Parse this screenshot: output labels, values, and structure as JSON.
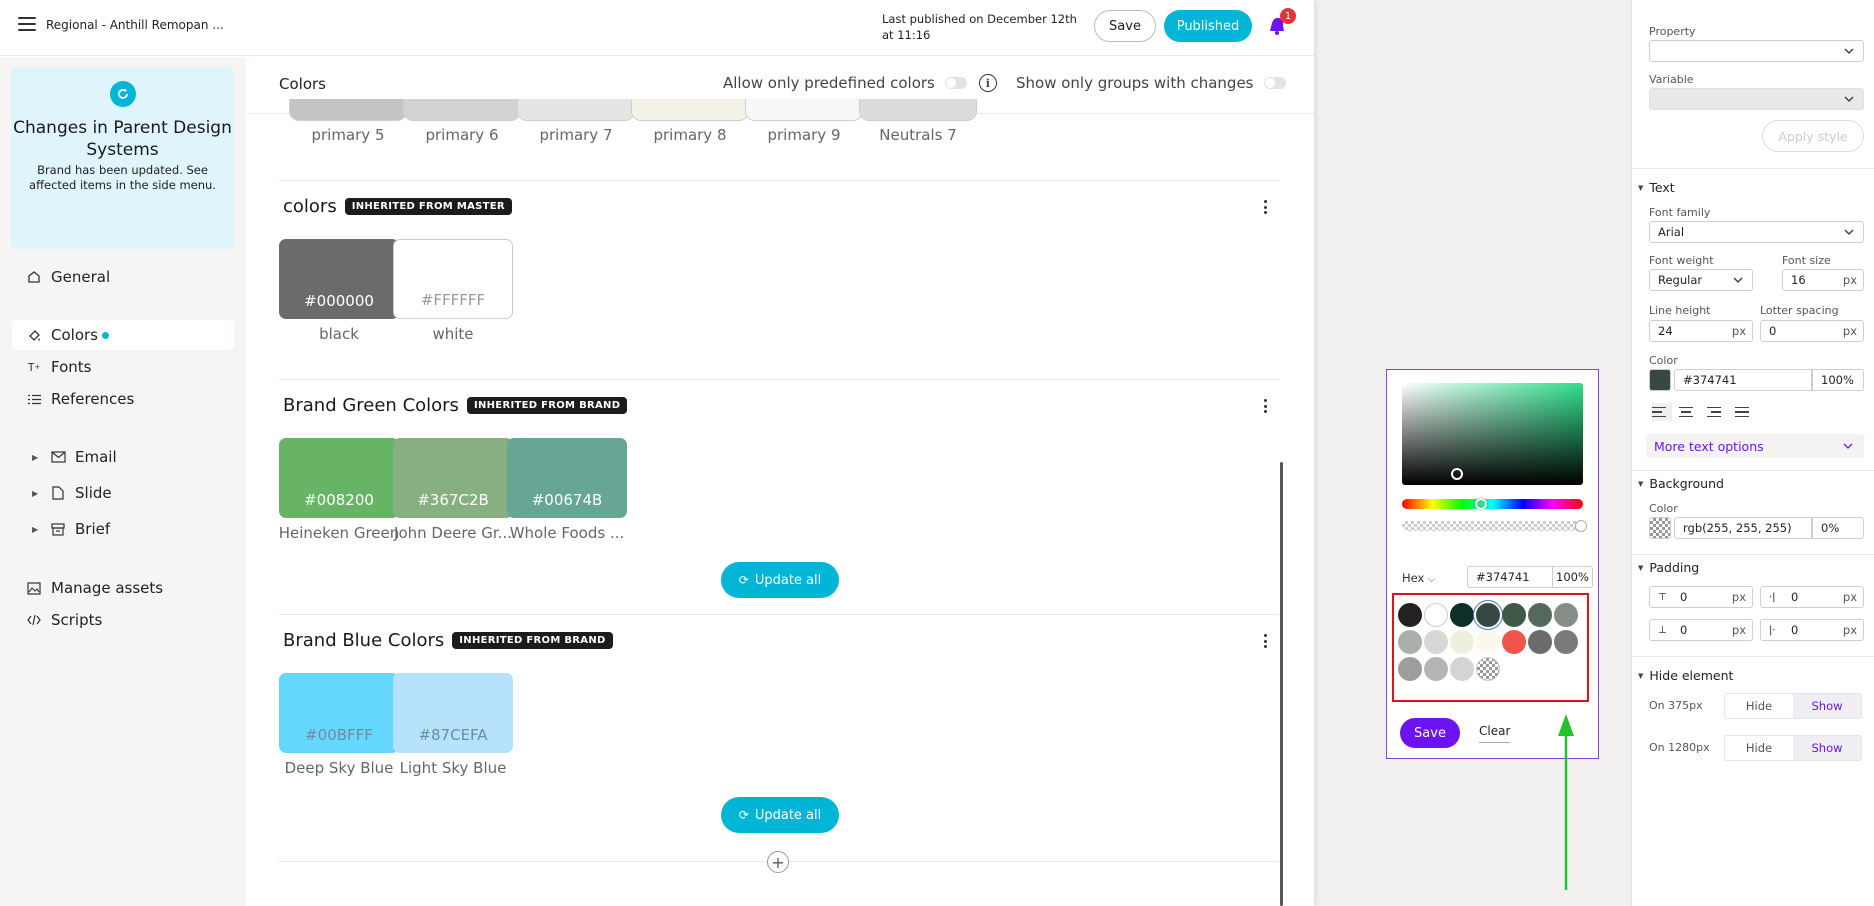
{
  "topbar": {
    "doc_title": "Regional - Anthill Remopan ...",
    "published_text": "Last published on December 12th at 11:16",
    "save_label": "Save",
    "published_label": "Published",
    "notification_count": "1"
  },
  "notice": {
    "title": "Changes in Parent Design Systems",
    "body": "Brand has been updated. See affected items in the side menu."
  },
  "sidebar": {
    "general": "General",
    "colors": "Colors",
    "fonts": "Fonts",
    "references": "References",
    "email": "Email",
    "slide": "Slide",
    "brief": "Brief",
    "manage_assets": "Manage assets",
    "scripts": "Scripts"
  },
  "content": {
    "header": "Colors",
    "toggle_predefined": "Allow only predefined colors",
    "toggle_groups": "Show only groups with changes",
    "top_row": [
      {
        "name": "primary 5",
        "color": "#c4c4c4"
      },
      {
        "name": "primary 6",
        "color": "#d2d2d2"
      },
      {
        "name": "primary 7",
        "color": "#e4e4e4"
      },
      {
        "name": "primary 8",
        "color": "#f4f2e6"
      },
      {
        "name": "primary 9",
        "color": "#f7f7f7"
      },
      {
        "name": "Neutrals 7",
        "color": "#dcdcdc"
      }
    ],
    "groups": [
      {
        "title": "colors",
        "badge": "INHERITED FROM MASTER",
        "swatches": [
          {
            "hex": "#000000",
            "name": "black",
            "bg": "#6b6b6b",
            "fg": "#ffffff"
          },
          {
            "hex": "#FFFFFF",
            "name": "white",
            "bg": "#ffffff",
            "fg": "#999999"
          }
        ]
      },
      {
        "title": "Brand Green Colors",
        "badge": "INHERITED FROM BRAND",
        "update_label": "Update all",
        "swatches": [
          {
            "hex": "#008200",
            "name": "Heineken Green",
            "bg": "#67b467",
            "fg": "#ffffff"
          },
          {
            "hex": "#367C2B",
            "name": "John Deere Gr...",
            "bg": "#88af82",
            "fg": "#ffffff"
          },
          {
            "hex": "#00674B",
            "name": "Whole Foods ...",
            "bg": "#67a595",
            "fg": "#ffffff"
          }
        ]
      },
      {
        "title": "Brand Blue Colors",
        "badge": "INHERITED FROM BRAND",
        "update_label": "Update all",
        "swatches": [
          {
            "hex": "#00BFFF",
            "name": "Deep Sky Blue",
            "bg": "#66d8ff",
            "fg": "#6a8fa0"
          },
          {
            "hex": "#87CEFA",
            "name": "Light Sky Blue",
            "bg": "#b7e2fc",
            "fg": "#6a8fa0"
          }
        ]
      }
    ]
  },
  "picker": {
    "mode": "Hex",
    "hex": "#374741",
    "alpha": "100%",
    "presets": [
      "#222222",
      "#ffffff",
      "#0f2e28",
      "#374741",
      "#3f5a48",
      "#56695e",
      "#858e86",
      "#a9b0aa",
      "#d5d8d5",
      "#efefe0",
      "#fbf8ec",
      "#f0554a",
      "#6b6b6b",
      "#7a7a7a",
      "#9d9d9d",
      "#b5b5b5",
      "#d4d4d4",
      "transparent"
    ],
    "save_label": "Save",
    "clear_label": "Clear"
  },
  "props": {
    "property_label": "Property",
    "variable_label": "Variable",
    "apply_label": "Apply style",
    "text_section": "Text",
    "font_family_label": "Font family",
    "font_family": "Arial",
    "font_weight_label": "Font weight",
    "font_weight": "Regular",
    "font_size_label": "Font size",
    "font_size": "16",
    "line_height_label": "Line height",
    "line_height": "24",
    "letter_spacing_label": "Lotter spacing",
    "letter_spacing": "0",
    "color_label": "Color",
    "color_hex": "#374741",
    "color_opacity": "100%",
    "more_text": "More text options",
    "background_section": "Background",
    "bg_color_label": "Color",
    "bg_value": "rgb(255, 255, 255)",
    "bg_opacity": "0%",
    "padding_section": "Padding",
    "pad_top": "0",
    "pad_right": "0",
    "pad_bottom": "0",
    "pad_left": "0",
    "unit_px": "px",
    "hide_section": "Hide element",
    "on_375": "On 375px",
    "on_1280": "On 1280px",
    "hide": "Hide",
    "show": "Show"
  }
}
